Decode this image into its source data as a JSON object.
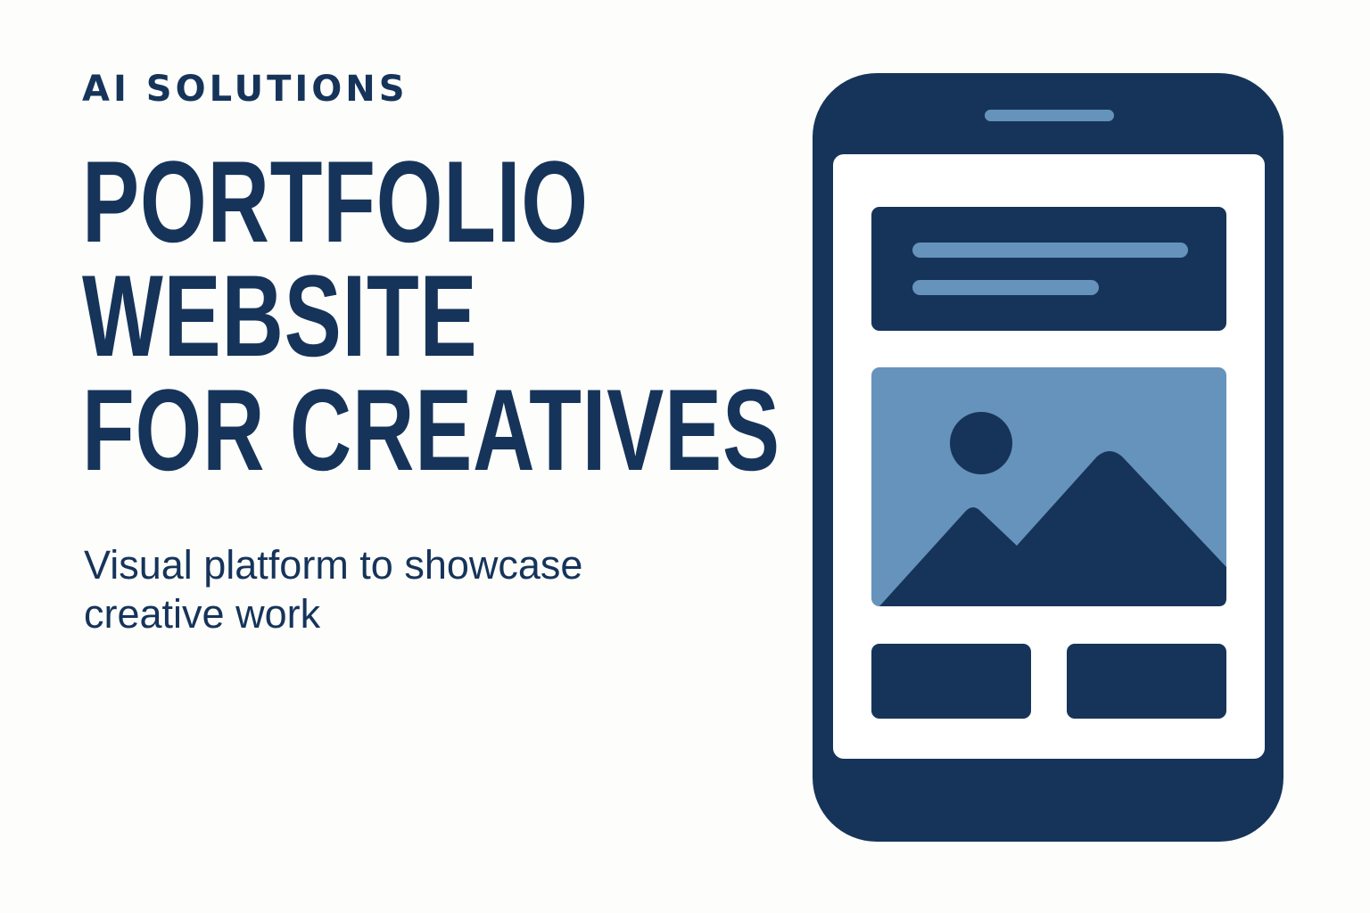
{
  "eyebrow": "AI SOLUTIONS",
  "headline": [
    "PORTFOLIO",
    "WEBSITE",
    "FOR CREATIVES"
  ],
  "subtitle": "Visual platform to showcase creative work",
  "colors": {
    "navy": "#16345a",
    "light_blue": "#6593bc",
    "background": "#fdfdfb",
    "screen": "#ffffff"
  },
  "illustration": {
    "device": "smartphone",
    "image_placeholder_icon": "landscape-image-icon"
  }
}
